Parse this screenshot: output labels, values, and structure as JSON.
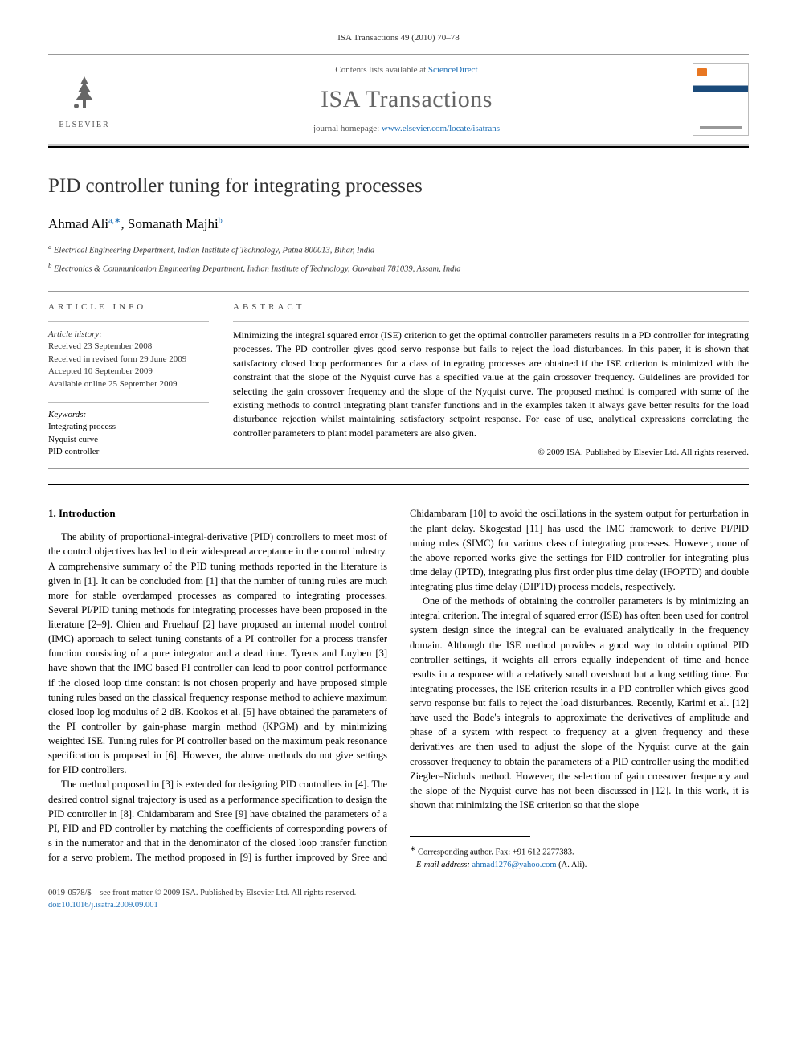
{
  "header_citation": "ISA Transactions 49 (2010) 70–78",
  "banner": {
    "contents_prefix": "Contents lists available at ",
    "contents_link": "ScienceDirect",
    "journal_name": "ISA Transactions",
    "homepage_prefix": "journal homepage: ",
    "homepage_link": "www.elsevier.com/locate/isatrans",
    "publisher_label": "ELSEVIER"
  },
  "title": "PID controller tuning for integrating processes",
  "authors_html": "Ahmad Ali",
  "author1_sup": "a,∗",
  "author2": ", Somanath Majhi",
  "author2_sup": "b",
  "affiliations": {
    "a": "Electrical Engineering Department, Indian Institute of Technology, Patna 800013, Bihar, India",
    "b": "Electronics & Communication Engineering Department, Indian Institute of Technology, Guwahati 781039, Assam, India"
  },
  "info": {
    "label": "ARTICLE INFO",
    "history_label": "Article history:",
    "received": "Received 23 September 2008",
    "revised": "Received in revised form 29 June 2009",
    "accepted": "Accepted 10 September 2009",
    "online": "Available online 25 September 2009",
    "keywords_label": "Keywords:",
    "keywords": [
      "Integrating process",
      "Nyquist curve",
      "PID controller"
    ]
  },
  "abstract": {
    "label": "ABSTRACT",
    "text": "Minimizing the integral squared error (ISE) criterion to get the optimal controller parameters results in a PD controller for integrating processes. The PD controller gives good servo response but fails to reject the load disturbances. In this paper, it is shown that satisfactory closed loop performances for a class of integrating processes are obtained if the ISE criterion is minimized with the constraint that the slope of the Nyquist curve has a specified value at the gain crossover frequency. Guidelines are provided for selecting the gain crossover frequency and the slope of the Nyquist curve. The proposed method is compared with some of the existing methods to control integrating plant transfer functions and in the examples taken it always gave better results for the load disturbance rejection whilst maintaining satisfactory setpoint response. For ease of use, analytical expressions correlating the controller parameters to plant model parameters are also given.",
    "copyright": "© 2009 ISA. Published by Elsevier Ltd. All rights reserved."
  },
  "body": {
    "section_heading": "1.  Introduction",
    "p1": "The ability of proportional-integral-derivative (PID) controllers to meet most of the control objectives has led to their widespread acceptance in the control industry. A comprehensive summary of the PID tuning methods reported in the literature is given in [1]. It can be concluded from [1] that the number of tuning rules are much more for stable overdamped processes as compared to integrating processes. Several PI/PID tuning methods for integrating processes have been proposed in the literature [2–9]. Chien and Fruehauf [2] have proposed an internal model control (IMC) approach to select tuning constants of a PI controller for a process transfer function consisting of a pure integrator and a dead time. Tyreus and Luyben [3] have shown that the IMC based PI controller can lead to poor control performance if the closed loop time constant is not chosen properly and have proposed simple tuning rules based on the classical frequency response method to achieve maximum closed loop log modulus of 2 dB. Kookos et al. [5] have obtained the parameters of the PI controller by gain-phase margin method (KPGM) and by minimizing weighted ISE. Tuning rules for PI controller based on the maximum peak resonance specification is proposed in [6]. However, the above methods do not give settings for PID controllers.",
    "p2": "The method proposed in [3] is extended for designing PID controllers in [4]. The desired control signal trajectory is used as a performance specification to design the PID controller in [8]. Chidambaram and Sree [9] have obtained the parameters of a PI, PID and PD controller by matching the coefficients of corresponding powers of s in the numerator and that in the denominator of the closed loop transfer function for a servo problem. The method proposed in [9] is further improved by Sree and Chidambaram [10] to avoid the oscillations in the system output for perturbation in the plant delay. Skogestad [11] has used the IMC framework to derive PI/PID tuning rules (SIMC) for various class of integrating processes. However, none of the above reported works give the settings for PID controller for integrating plus time delay (IPTD), integrating plus first order plus time delay (IFOPTD) and double integrating plus time delay (DIPTD) process models, respectively.",
    "p3": "One of the methods of obtaining the controller parameters is by minimizing an integral criterion. The integral of squared error (ISE) has often been used for control system design since the integral can be evaluated analytically in the frequency domain. Although the ISE method provides a good way to obtain optimal PID controller settings, it weights all errors equally independent of time and hence results in a response with a relatively small overshoot but a long settling time. For integrating processes, the ISE criterion results in a PD controller which gives good servo response but fails to reject the load disturbances. Recently, Karimi et al. [12] have used the Bode's integrals to approximate the derivatives of amplitude and phase of a system with respect to frequency at a given frequency and these derivatives are then used to adjust the slope of the Nyquist curve at the gain crossover frequency to obtain the parameters of a PID controller using the modified Ziegler–Nichols method. However, the selection of gain crossover frequency and the slope of the Nyquist curve has not been discussed in [12]. In this work, it is shown that minimizing the ISE criterion so that the slope"
  },
  "footer": {
    "corr_label": "Corresponding author. Fax: +91 612 2277383.",
    "email_label": "E-mail address:",
    "email": "ahmad1276@yahoo.com",
    "email_name": "(A. Ali).",
    "front_matter": "0019-0578/$ – see front matter © 2009 ISA. Published by Elsevier Ltd. All rights reserved.",
    "doi": "doi:10.1016/j.isatra.2009.09.001"
  }
}
